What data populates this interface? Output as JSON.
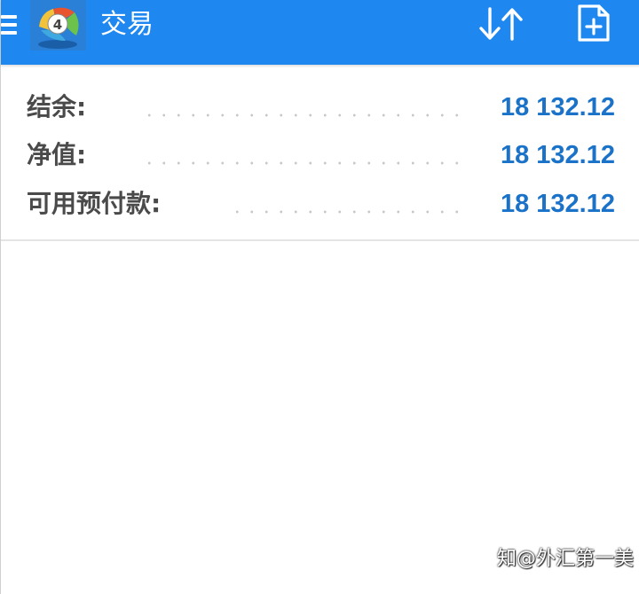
{
  "header": {
    "title": "交易",
    "menu_icon": "hamburger-menu-icon",
    "logo_icon": "metatrader-4-logo",
    "sort_icon": "sort-arrows-icon",
    "new_order_icon": "new-document-plus-icon",
    "bar_color": "#1e88f0"
  },
  "account": {
    "rows": [
      {
        "label": "结余:",
        "value": "18 132.12"
      },
      {
        "label": "净值:",
        "value": "18 132.12"
      },
      {
        "label": "可用预付款:",
        "value": "18 132.12"
      }
    ],
    "label_color": "#4a4a4a",
    "value_color": "#1a73c8"
  },
  "watermark": {
    "text": "知@外汇第一美"
  }
}
